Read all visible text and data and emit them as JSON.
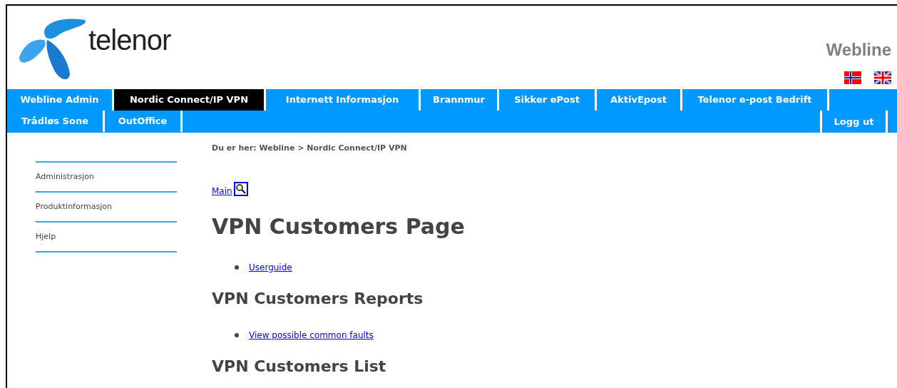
{
  "logo": {
    "text": "telenor"
  },
  "site_title": "Webline",
  "nav": {
    "row_1": [
      {
        "label": "Webline Admin",
        "selected": false
      },
      {
        "label": "Nordic Connect/IP VPN",
        "selected": true
      },
      {
        "label": "Internett Informasjon",
        "selected": false
      },
      {
        "label": "Brannmur",
        "selected": false
      },
      {
        "label": "Sikker ePost",
        "selected": false
      },
      {
        "label": "AktivEpost",
        "selected": false
      },
      {
        "label": "Telenor e-post Bedrift",
        "selected": false
      }
    ],
    "row_2": [
      {
        "label": "Trådløs Sone",
        "selected": false
      },
      {
        "label": "OutOffice",
        "selected": false
      }
    ],
    "logout": "Logg ut"
  },
  "sidebar": {
    "items": [
      "Administrasjon",
      "Produktinformasjon",
      "Hjelp"
    ]
  },
  "breadcrumb": "Du er her: Webline > Nordic Connect/IP VPN",
  "main_link": "Main",
  "page_title": "VPN Customers Page",
  "sections": [
    {
      "links": [
        "Userguide"
      ]
    },
    {
      "heading": "VPN Customers Reports",
      "links": [
        "View possible common faults"
      ]
    },
    {
      "heading": "VPN Customers List"
    }
  ]
}
